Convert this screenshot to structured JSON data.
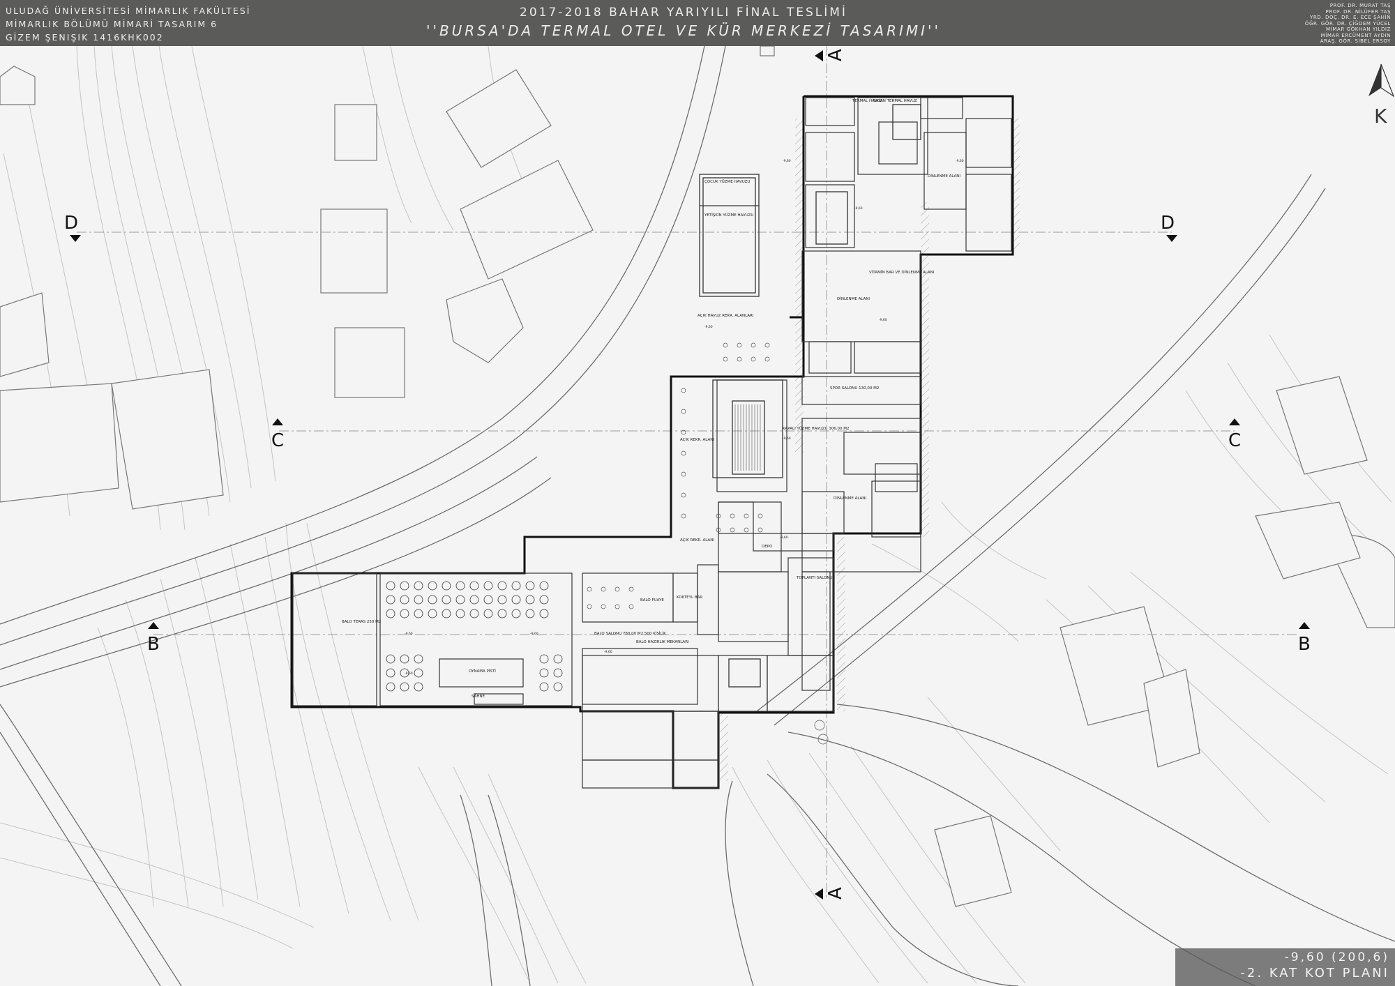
{
  "header": {
    "left_lines": [
      "ULUDAĞ ÜNİVERSİTESİ MİMARLIK FAKÜLTESİ",
      "MİMARLIK BÖLÜMÜ MİMARİ TASARIM 6",
      "GİZEM ŞENIŞIK 1416KHK002"
    ],
    "title": "2017-2018 BAHAR YARIYILI FİNAL TESLİMİ",
    "subtitle": "''BURSA'DA TERMAL OTEL VE  KÜR MERKEZİ TASARIMI''",
    "right_lines": [
      "PROF. DR. MURAT TAŞ",
      "PROF. DR. NİLÜFER TAŞ",
      "YRD. DOÇ. DR. E. ECE ŞAHİN",
      "ÖĞR. GÖR. DR. ÇİĞDEM YÜCEL",
      "MİMAR GÖKHAN YILDIZ",
      "MİMAR ERCÜMENT AYDIN",
      "ARAŞ. GÖR. SİBEL ERSOY"
    ]
  },
  "north": {
    "letter": "K"
  },
  "sections": {
    "a": "A",
    "b": "B",
    "c": "C",
    "d": "D"
  },
  "rooms": {
    "cocuk_havuzu": "ÇOCUK YÜZME HAVUZU",
    "yetiskin_havuzu": "YETİŞKİN YÜZME HAVUZU",
    "acik_havuz": "AÇIK HAVUZ REKR. ALANLARI",
    "acik_rekr_1": "AÇIK REKR. ALANI",
    "acik_rekr_2": "AÇIK REKR. ALANI",
    "kapali_havuz": "KAPALI YÜZME HAVUZU 306,00 M2",
    "termal_havuz": "TERMAL HAVUZ",
    "bayan_termal": "BAYAN TERMAL HAVUZ",
    "dinlenme_1": "DİNLENME ALANI",
    "dinlenme_2": "DİNLENME ALANI",
    "dinlenme_3": "DİNLENME ALANI",
    "vitamin_bar": "VİTAMİN BAR VE DİNLENME ALANI",
    "fitness": "SPOR SALONU 130,00 M2",
    "kokteyl_bar": "KOKTEYL BAR",
    "balo_fuaye": "BALO FUAYE",
    "balo_salonu": "BALO SALONU 780,00 M2 500 KİŞİLİK",
    "balo_hazirlik": "BALO HAZIRLIK MEKANLARI",
    "balo_teras": "BALO TERAS 250 M2",
    "dans_pisti": "OYNAMA PİSTİ",
    "sahne": "SAHNE",
    "depo": "DEPO",
    "toplanti": "TOPLANTI SALONU"
  },
  "elevation_tag": "-9,60",
  "level": {
    "elevation": "-9,60 (200,6)",
    "name": "-2. KAT KOT PLANI"
  }
}
